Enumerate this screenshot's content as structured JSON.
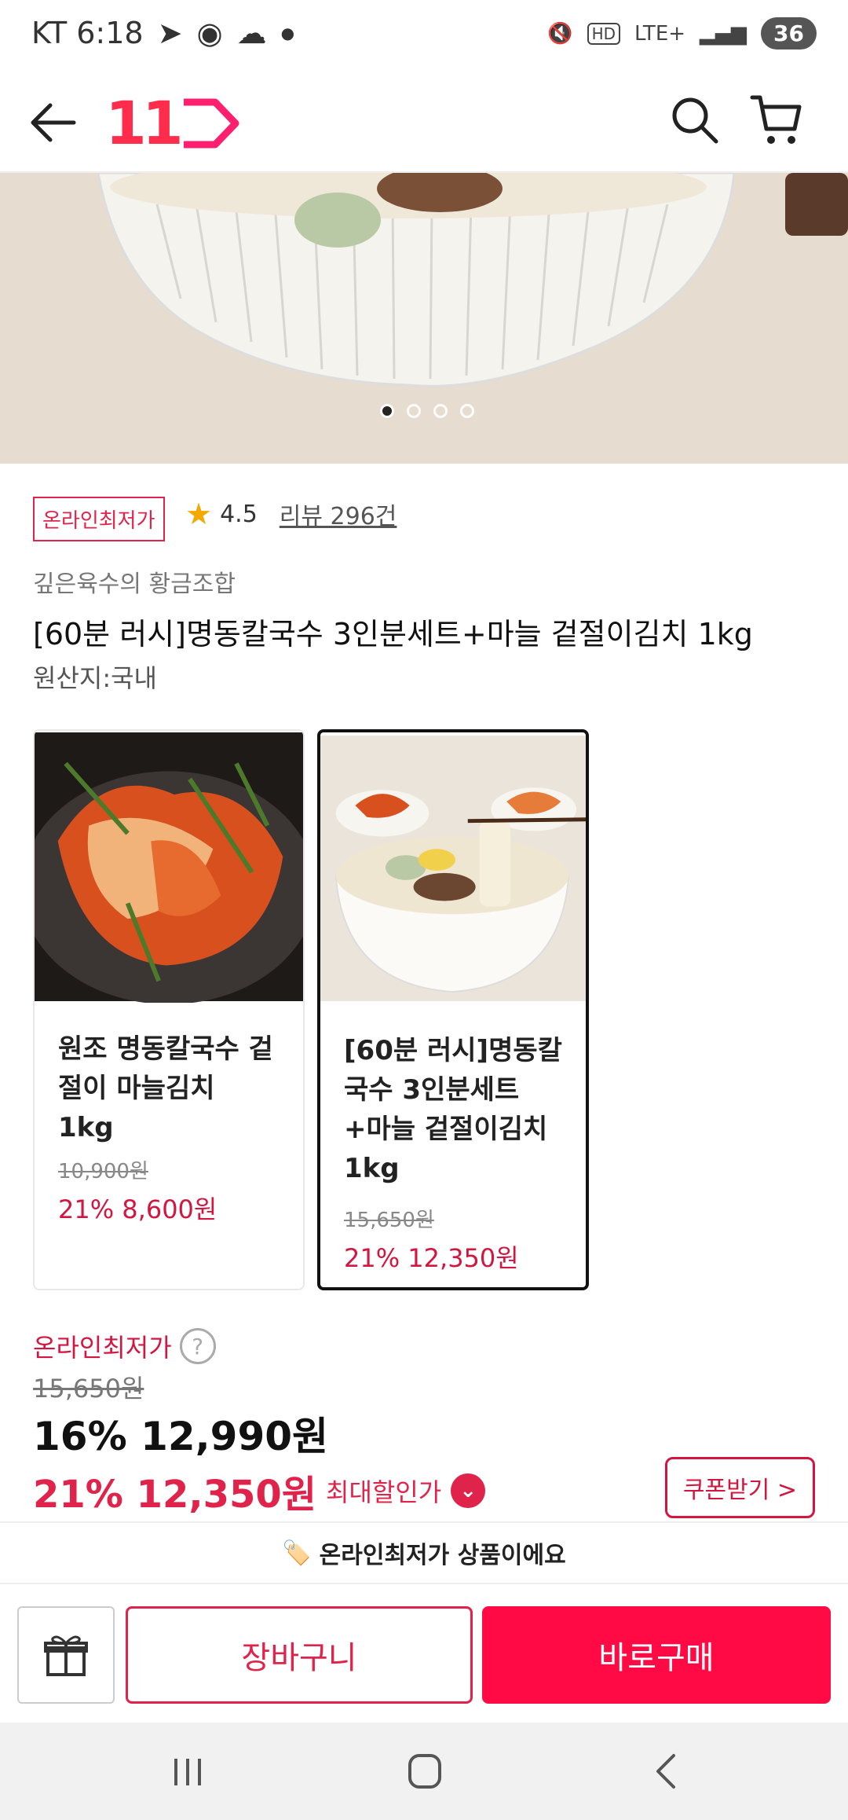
{
  "status_bar": {
    "carrier_time": "KT 6:18",
    "network": "LTE+",
    "battery": "36"
  },
  "header": {
    "logo": "11",
    "icons": [
      "back-arrow-icon",
      "search-icon",
      "cart-icon"
    ]
  },
  "gallery": {
    "image_count": 4,
    "active_index": 0
  },
  "product": {
    "badge": "온라인최저가",
    "rating": "4.5",
    "review_text": "리뷰 296건",
    "seller": "깊은육수의 황금조합",
    "title": "[60분 러시]명동칼국수 3인분세트+마늘 겉절이김치 1kg",
    "origin": "원산지:국내"
  },
  "options": [
    {
      "name": "원조 명동칼국수 겉절이 마늘김치 1kg",
      "original_price": "10,900원",
      "sale_price": "21% 8,600원",
      "selected": false
    },
    {
      "name": "[60분 러시]명동칼국수 3인분세트+마늘 겉절이김치 1kg",
      "original_price": "15,650원",
      "sale_price": "21% 12,350원",
      "selected": true
    }
  ],
  "price": {
    "label": "온라인최저가",
    "help": "?",
    "original": "15,650원",
    "main": "16% 12,990원",
    "max_discount_price": "21% 12,350원",
    "max_discount_label": "최대할인가",
    "coupon_button": "쿠폰받기 >"
  },
  "notice": {
    "icon": "🏷️",
    "text": "온라인최저가 상품이에요"
  },
  "actions": {
    "cart": "장바구니",
    "buy": "바로구매"
  },
  "colors": {
    "accent": "#e0234a",
    "buy_button": "#ff0a45",
    "star": "#f5a800"
  }
}
